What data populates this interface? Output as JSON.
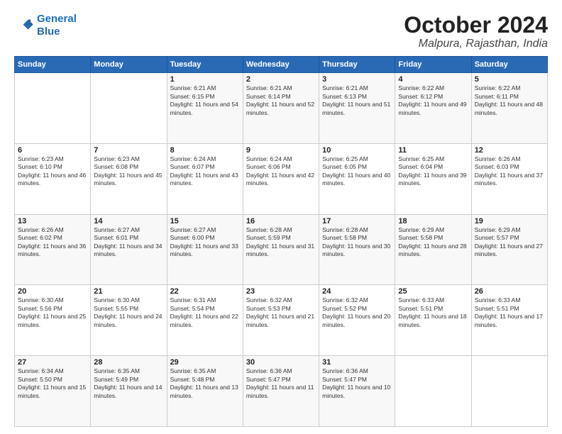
{
  "logo": {
    "line1": "General",
    "line2": "Blue"
  },
  "header": {
    "month": "October 2024",
    "location": "Malpura, Rajasthan, India"
  },
  "weekdays": [
    "Sunday",
    "Monday",
    "Tuesday",
    "Wednesday",
    "Thursday",
    "Friday",
    "Saturday"
  ],
  "weeks": [
    [
      {
        "day": "",
        "info": ""
      },
      {
        "day": "",
        "info": ""
      },
      {
        "day": "1",
        "info": "Sunrise: 6:21 AM\nSunset: 6:15 PM\nDaylight: 11 hours and 54 minutes."
      },
      {
        "day": "2",
        "info": "Sunrise: 6:21 AM\nSunset: 6:14 PM\nDaylight: 11 hours and 52 minutes."
      },
      {
        "day": "3",
        "info": "Sunrise: 6:21 AM\nSunset: 6:13 PM\nDaylight: 11 hours and 51 minutes."
      },
      {
        "day": "4",
        "info": "Sunrise: 6:22 AM\nSunset: 6:12 PM\nDaylight: 11 hours and 49 minutes."
      },
      {
        "day": "5",
        "info": "Sunrise: 6:22 AM\nSunset: 6:11 PM\nDaylight: 11 hours and 48 minutes."
      }
    ],
    [
      {
        "day": "6",
        "info": "Sunrise: 6:23 AM\nSunset: 6:10 PM\nDaylight: 11 hours and 46 minutes."
      },
      {
        "day": "7",
        "info": "Sunrise: 6:23 AM\nSunset: 6:08 PM\nDaylight: 11 hours and 45 minutes."
      },
      {
        "day": "8",
        "info": "Sunrise: 6:24 AM\nSunset: 6:07 PM\nDaylight: 11 hours and 43 minutes."
      },
      {
        "day": "9",
        "info": "Sunrise: 6:24 AM\nSunset: 6:06 PM\nDaylight: 11 hours and 42 minutes."
      },
      {
        "day": "10",
        "info": "Sunrise: 6:25 AM\nSunset: 6:05 PM\nDaylight: 11 hours and 40 minutes."
      },
      {
        "day": "11",
        "info": "Sunrise: 6:25 AM\nSunset: 6:04 PM\nDaylight: 11 hours and 39 minutes."
      },
      {
        "day": "12",
        "info": "Sunrise: 6:26 AM\nSunset: 6:03 PM\nDaylight: 11 hours and 37 minutes."
      }
    ],
    [
      {
        "day": "13",
        "info": "Sunrise: 6:26 AM\nSunset: 6:02 PM\nDaylight: 11 hours and 36 minutes."
      },
      {
        "day": "14",
        "info": "Sunrise: 6:27 AM\nSunset: 6:01 PM\nDaylight: 11 hours and 34 minutes."
      },
      {
        "day": "15",
        "info": "Sunrise: 6:27 AM\nSunset: 6:00 PM\nDaylight: 11 hours and 33 minutes."
      },
      {
        "day": "16",
        "info": "Sunrise: 6:28 AM\nSunset: 5:59 PM\nDaylight: 11 hours and 31 minutes."
      },
      {
        "day": "17",
        "info": "Sunrise: 6:28 AM\nSunset: 5:58 PM\nDaylight: 11 hours and 30 minutes."
      },
      {
        "day": "18",
        "info": "Sunrise: 6:29 AM\nSunset: 5:58 PM\nDaylight: 11 hours and 28 minutes."
      },
      {
        "day": "19",
        "info": "Sunrise: 6:29 AM\nSunset: 5:57 PM\nDaylight: 11 hours and 27 minutes."
      }
    ],
    [
      {
        "day": "20",
        "info": "Sunrise: 6:30 AM\nSunset: 5:56 PM\nDaylight: 11 hours and 25 minutes."
      },
      {
        "day": "21",
        "info": "Sunrise: 6:30 AM\nSunset: 5:55 PM\nDaylight: 11 hours and 24 minutes."
      },
      {
        "day": "22",
        "info": "Sunrise: 6:31 AM\nSunset: 5:54 PM\nDaylight: 11 hours and 22 minutes."
      },
      {
        "day": "23",
        "info": "Sunrise: 6:32 AM\nSunset: 5:53 PM\nDaylight: 11 hours and 21 minutes."
      },
      {
        "day": "24",
        "info": "Sunrise: 6:32 AM\nSunset: 5:52 PM\nDaylight: 11 hours and 20 minutes."
      },
      {
        "day": "25",
        "info": "Sunrise: 6:33 AM\nSunset: 5:51 PM\nDaylight: 11 hours and 18 minutes."
      },
      {
        "day": "26",
        "info": "Sunrise: 6:33 AM\nSunset: 5:51 PM\nDaylight: 11 hours and 17 minutes."
      }
    ],
    [
      {
        "day": "27",
        "info": "Sunrise: 6:34 AM\nSunset: 5:50 PM\nDaylight: 11 hours and 15 minutes."
      },
      {
        "day": "28",
        "info": "Sunrise: 6:35 AM\nSunset: 5:49 PM\nDaylight: 11 hours and 14 minutes."
      },
      {
        "day": "29",
        "info": "Sunrise: 6:35 AM\nSunset: 5:48 PM\nDaylight: 11 hours and 13 minutes."
      },
      {
        "day": "30",
        "info": "Sunrise: 6:36 AM\nSunset: 5:47 PM\nDaylight: 11 hours and 11 minutes."
      },
      {
        "day": "31",
        "info": "Sunrise: 6:36 AM\nSunset: 5:47 PM\nDaylight: 11 hours and 10 minutes."
      },
      {
        "day": "",
        "info": ""
      },
      {
        "day": "",
        "info": ""
      }
    ]
  ]
}
